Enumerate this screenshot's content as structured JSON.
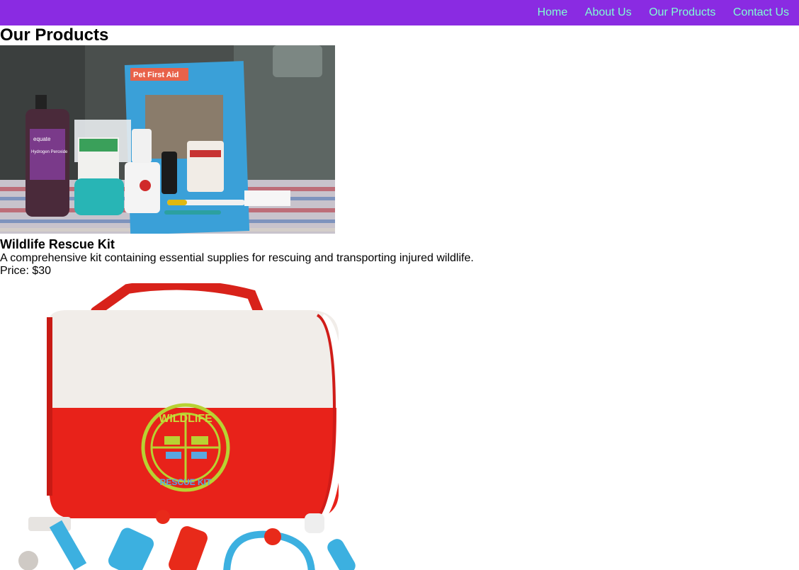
{
  "nav": {
    "links": [
      {
        "label": "Home"
      },
      {
        "label": "About Us"
      },
      {
        "label": "Our Products"
      },
      {
        "label": "Contact Us"
      }
    ]
  },
  "page": {
    "title": "Our Products"
  },
  "products": [
    {
      "name": "Wildlife Rescue Kit",
      "description": "A comprehensive kit containing essential supplies for rescuing and transporting injured wildlife.",
      "price": "Price: $30",
      "image": "pet-first-aid-kit-photo",
      "image_texts": {
        "book": "Pet First Aid",
        "bottle_brand": "equate",
        "bottle_label": "Hydrogen Peroxide"
      }
    },
    {
      "image": "wildlife-rescue-bag-photo",
      "image_texts": {
        "logo_top": "WILDLIFE",
        "logo_bottom": "RESCUE KIT"
      }
    }
  ],
  "colors": {
    "nav_bg": "#8a2be2",
    "nav_link": "#7fffd4"
  }
}
